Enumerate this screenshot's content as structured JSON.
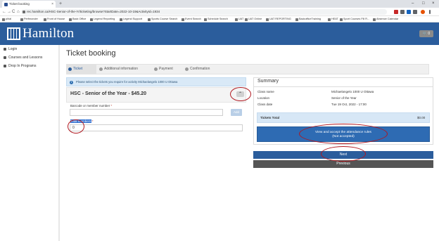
{
  "browser": {
    "tab_title": "Ticket booking",
    "tab_close": "×",
    "new_tab": "+",
    "window_controls": [
      "–",
      "□",
      "×"
    ],
    "nav": [
      "←",
      "→",
      "C",
      "⌂"
    ],
    "url": "rec.hamilton.ca/HSC-Senior-of-the-Yr/ticketing/browse?StartDate=2022-10-19&ActivityId=1934",
    "bookmarks": [
      "pihal",
      "Perfmonder",
      "Front of House",
      "Back Office",
      "Legend Reporting",
      "Legend Support",
      "Sports Course Search",
      "Event Search",
      "Schedule Search",
      "UAT",
      "UAT Online",
      "UAT REPORTING",
      "BackofficeTraining",
      "HEAT",
      "Sport Courses Fill R...",
      "Absence Calendar"
    ]
  },
  "site": {
    "logo_text": "Hamilton",
    "cart_count": "0"
  },
  "sidebar": {
    "items": [
      {
        "label": "Login",
        "icon": "login-icon"
      },
      {
        "label": "Courses and Lessons",
        "icon": "courses-icon"
      },
      {
        "label": "Drop In Programs",
        "icon": "calendar-icon"
      }
    ]
  },
  "main": {
    "page_title": "Ticket booking",
    "steps": [
      {
        "label": "Ticket",
        "active": true
      },
      {
        "label": "Additional information",
        "active": false
      },
      {
        "label": "Payment",
        "active": false
      },
      {
        "label": "Confirmation",
        "active": false
      }
    ],
    "info_text": "Please select the tickets you require for activity Michaelangelo 1000 U Ottawa",
    "product_title": "HSC - Senior of the Year - $45.20",
    "collapse_glyph": "⌃",
    "barcode_label": "Barcode or member number",
    "required_mark": "*",
    "barcode_value": "",
    "add_button": "Add",
    "members_label": "Total members",
    "members_value": "0"
  },
  "summary": {
    "title": "Summary",
    "rows": [
      {
        "label": "Class name",
        "value": "Michaelangelo 1000 U Ottawa"
      },
      {
        "label": "Location",
        "value": "Senior of the Year"
      },
      {
        "label": "Class date",
        "value": "Tue 19 Oct, 2022 - 17:00"
      }
    ],
    "tickets_total_label": "Tickets Total",
    "tickets_total_value": "$0.00",
    "rules_button_line1": "View and accept the attendance rules",
    "rules_button_line2": "(Not accepted)",
    "next_button": "Next",
    "previous_button": "Previous"
  },
  "colors": {
    "brand_blue": "#2b5d9c",
    "button_blue": "#2e6bb3",
    "annotation_red": "#b0171f",
    "previous_gray": "#555555"
  }
}
